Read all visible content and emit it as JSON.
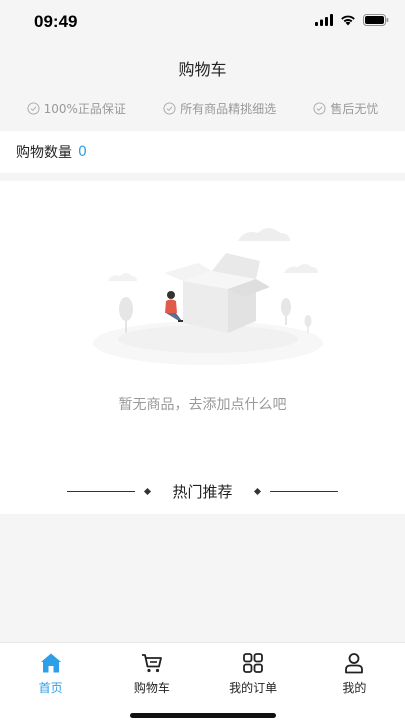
{
  "status_bar": {
    "time": "09:49"
  },
  "header": {
    "title": "购物车"
  },
  "guarantees": [
    {
      "label": "100%正品保证",
      "icon": "check-circle-icon"
    },
    {
      "label": "所有商品精挑细选",
      "icon": "check-circle-icon"
    },
    {
      "label": "售后无忧",
      "icon": "check-circle-icon"
    }
  ],
  "cart": {
    "count_label": "购物数量",
    "count_value": "0"
  },
  "empty_state": {
    "message": "暂无商品，去添加点什么吧",
    "illustration": "empty-box-illustration"
  },
  "recommend": {
    "title": "热门推荐"
  },
  "tab_bar": {
    "items": [
      {
        "label": "首页",
        "icon": "home-icon",
        "active": true
      },
      {
        "label": "购物车",
        "icon": "cart-icon",
        "active": false
      },
      {
        "label": "我的订单",
        "icon": "grid-icon",
        "active": false
      },
      {
        "label": "我的",
        "icon": "user-icon",
        "active": false
      }
    ]
  },
  "colors": {
    "accent": "#2d9ee8",
    "background": "#f5f5f5",
    "muted_text": "#999999"
  }
}
